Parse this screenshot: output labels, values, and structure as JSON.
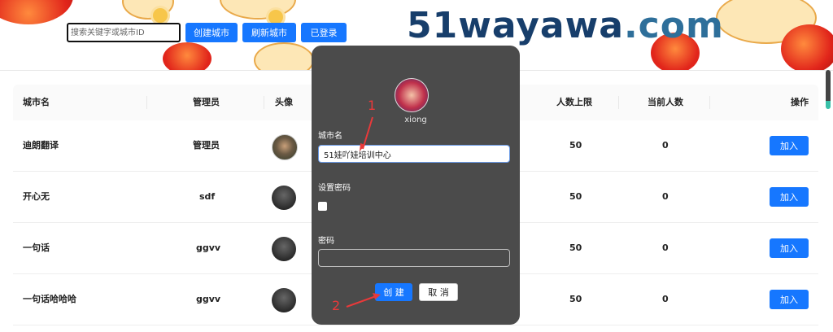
{
  "header": {
    "search": {
      "placeholder": "搜索关键字或城市ID",
      "value": ""
    },
    "buttons": {
      "create_city": "创建城市",
      "refresh_city": "刷新城市",
      "logged_in": "已登录"
    },
    "logo": {
      "main": "51wayawa",
      "tld": ".com"
    }
  },
  "table": {
    "columns": [
      "城市名",
      "管理员",
      "头像",
      "人数上限",
      "当前人数",
      "操作"
    ],
    "rows": [
      {
        "city": "迪朗翻译",
        "admin": "管理员",
        "limit": "50",
        "current": "0",
        "action": "加入"
      },
      {
        "city": "开心无",
        "admin": "sdf",
        "limit": "50",
        "current": "0",
        "action": "加入"
      },
      {
        "city": "一句话",
        "admin": "ggvv",
        "limit": "50",
        "current": "0",
        "action": "加入"
      },
      {
        "city": "一句话哈哈哈",
        "admin": "ggvv",
        "limit": "50",
        "current": "0",
        "action": "加入"
      }
    ]
  },
  "modal": {
    "username": "xiong",
    "city_label": "城市名",
    "city_value": "51娃吖娃培训中心",
    "set_password_label": "设置密码",
    "password_label": "密码",
    "password_value": "",
    "create_button": "创 建",
    "cancel_button": "取 消"
  },
  "annotations": {
    "step1": "1",
    "step2": "2"
  },
  "colors": {
    "primary": "#1677ff",
    "modal_bg": "#4b4b4b",
    "annotation": "#e8393a",
    "logo": "#173e6b"
  }
}
